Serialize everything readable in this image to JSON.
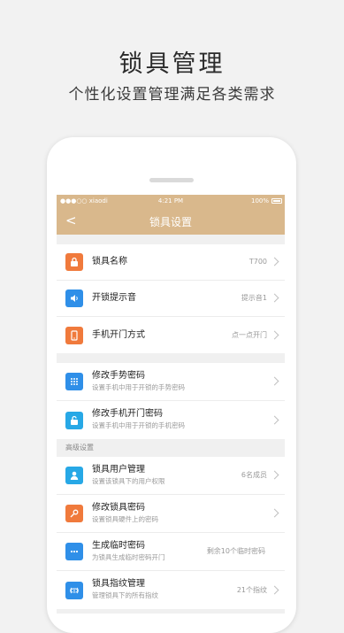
{
  "promo": {
    "title": "锁具管理",
    "subtitle": "个性化设置管理满足各类需求"
  },
  "statusbar": {
    "carrier": "●●●○○ xiaodi",
    "time": "4:21 PM",
    "battery": "100%"
  },
  "navbar": {
    "back": "<",
    "title": "锁具设置"
  },
  "group1": [
    {
      "label": "锁具名称",
      "value": "T700",
      "icon": "lock-icon",
      "color": "#f07a3c"
    },
    {
      "label": "开锁提示音",
      "value": "提示音1",
      "icon": "speaker-icon",
      "color": "#2f8fe8"
    },
    {
      "label": "手机开门方式",
      "value": "点一点开门",
      "icon": "phone-icon",
      "color": "#f07a3c"
    }
  ],
  "group2": [
    {
      "label": "修改手势密码",
      "sub": "设置手机中用于开锁的手势密码",
      "icon": "keypad-icon",
      "color": "#2f8fe8"
    },
    {
      "label": "修改手机开门密码",
      "sub": "设置手机中用于开锁的手机密码",
      "icon": "unlock-icon",
      "color": "#27a8e6"
    }
  ],
  "advanced": {
    "section_label": "高级设置",
    "items": [
      {
        "label": "锁具用户管理",
        "sub": "设置该锁具下的用户权限",
        "value": "6名成员",
        "icon": "user-icon",
        "color": "#27a8e6"
      },
      {
        "label": "修改锁具密码",
        "sub": "设置锁具硬件上的密码",
        "value": "",
        "icon": "key-icon",
        "color": "#f07a3c"
      },
      {
        "label": "生成临时密码",
        "sub": "为锁具生成临时密码开门",
        "value": "剩余10个临时密码",
        "icon": "dots-icon",
        "color": "#2f8fe8"
      },
      {
        "label": "锁具指纹管理",
        "sub": "管理锁具下的所有指纹",
        "value": "21个指纹",
        "icon": "fingerprint-icon",
        "color": "#2f8fe8"
      }
    ]
  }
}
